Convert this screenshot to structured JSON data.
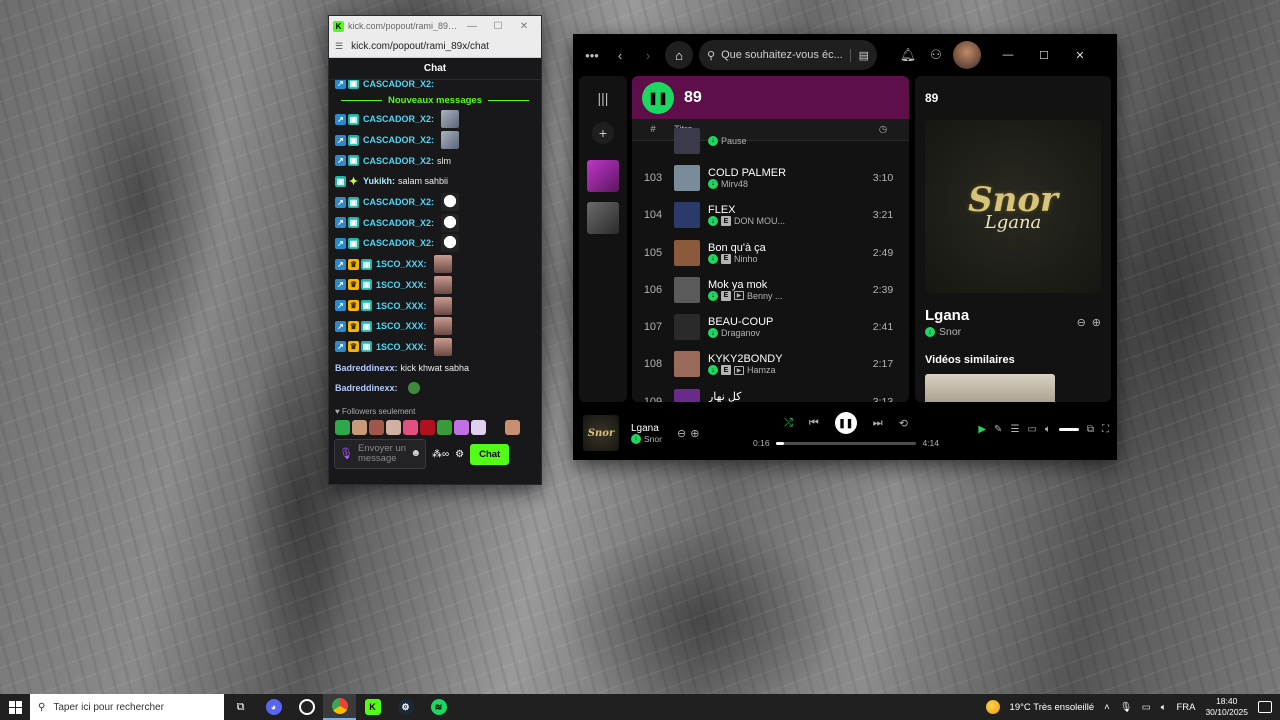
{
  "kick": {
    "title_bar": "kick.com/popout/rami_89x/...",
    "url": "kick.com/popout/rami_89x/chat",
    "chat_title": "Chat",
    "top_cut_user": "CASCADOR_X2:",
    "new_messages_label": "Nouveaux messages",
    "messages": [
      {
        "user": "CASCADOR_X2:",
        "text": "",
        "emote": "knife-emote"
      },
      {
        "user": "CASCADOR_X2:",
        "text": "",
        "emote": "knife-emote"
      },
      {
        "user": "CASCADOR_X2:",
        "text": "slm",
        "emote": ""
      },
      {
        "user": "Yukikh:",
        "text": "salam sahbii",
        "emote": ""
      },
      {
        "user": "CASCADOR_X2:",
        "text": "",
        "emote": "mask-emote"
      },
      {
        "user": "CASCADOR_X2:",
        "text": "",
        "emote": "mask-emote"
      },
      {
        "user": "CASCADOR_X2:",
        "text": "",
        "emote": "mask-emote"
      },
      {
        "user": "1SCO_XXX:",
        "text": "",
        "emote": "face-emote"
      },
      {
        "user": "1SCO_XXX:",
        "text": "",
        "emote": "face-emote"
      },
      {
        "user": "1SCO_XXX:",
        "text": "",
        "emote": "face-emote"
      },
      {
        "user": "1SCO_XXX:",
        "text": "",
        "emote": "face-emote"
      },
      {
        "user": "1SCO_XXX:",
        "text": "",
        "emote": "face-emote"
      },
      {
        "user": "Badreddinexx:",
        "text": "kick khwat sabha",
        "emote": ""
      },
      {
        "user": "Badreddinexx:",
        "text": "",
        "emote": "frog-emote"
      }
    ],
    "followers_only": "Followers seulement",
    "input_placeholder": "Envoyer un message",
    "chat_button": "Chat",
    "accent": "#53fc18"
  },
  "spotify": {
    "search_placeholder": "Que souhaitez-vous éc...",
    "playlist_title": "89",
    "col_number": "#",
    "col_title": "Titre",
    "tracks": [
      {
        "num": "",
        "title": "",
        "artist": "Pause",
        "explicit": false,
        "video": false,
        "duration": "",
        "color": "#3a3a4a"
      },
      {
        "num": "103",
        "title": "COLD PALMER",
        "artist": "Mirv48",
        "explicit": false,
        "video": false,
        "duration": "3:10",
        "color": "#7a8b9a"
      },
      {
        "num": "104",
        "title": "FLEX",
        "artist": "DON MOU...",
        "explicit": true,
        "video": false,
        "duration": "3:21",
        "color": "#2a3a6a"
      },
      {
        "num": "105",
        "title": "Bon qu'à ça",
        "artist": "Ninho",
        "explicit": true,
        "video": false,
        "duration": "2:49",
        "color": "#8a5a3a"
      },
      {
        "num": "106",
        "title": "Mok ya mok",
        "artist": "Benny ...",
        "explicit": true,
        "video": true,
        "duration": "2:39",
        "color": "#5a5a5a"
      },
      {
        "num": "107",
        "title": "BEAU-COUP",
        "artist": "Draganov",
        "explicit": false,
        "video": false,
        "duration": "2:41",
        "color": "#2a2a2a"
      },
      {
        "num": "108",
        "title": "KYKY2BONDY",
        "artist": "Hamza",
        "explicit": true,
        "video": true,
        "duration": "2:17",
        "color": "#9a6a5a"
      },
      {
        "num": "109",
        "title": "كل نهار",
        "artist": "",
        "explicit": false,
        "video": false,
        "duration": "3:13",
        "color": "#6a2a8a"
      }
    ],
    "right_panel_title": "89",
    "now_playing_title": "Lgana",
    "now_playing_artist": "Snor",
    "art_logo_line1": "Snor",
    "art_logo_line2": "Lgana",
    "similar_videos": "Vidéos similaires",
    "player_title": "Lgana",
    "player_artist": "Snor",
    "elapsed": "0:16",
    "total": "4:14",
    "progress_fraction": 0.063,
    "accent": "#1ed760",
    "header_color": "#5e0e49"
  },
  "taskbar": {
    "search_placeholder": "Taper ici pour rechercher",
    "weather": "19°C  Très ensoleillé",
    "language": "FRA",
    "time": "18:40",
    "date": "30/10/2025"
  }
}
